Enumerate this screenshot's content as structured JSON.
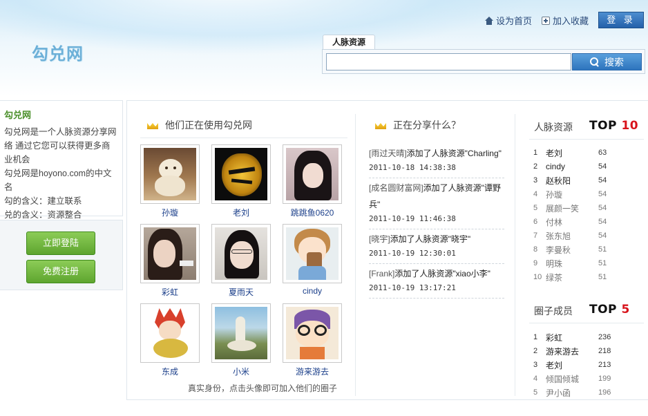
{
  "header": {
    "logo": "勾兑网",
    "set_home": "设为首页",
    "add_favorite": "加入收藏",
    "login": "登 录"
  },
  "search": {
    "tab": "人脉资源",
    "value": "",
    "button": "搜索"
  },
  "about": {
    "title": "勾兑网",
    "lines": [
      "勾兑网是一个人脉资源分享网络 通过它您可以获得更多商业机会",
      "勾兑网是hoyono.com的中文名",
      "勾的含义：建立联系",
      "兑的含义：资源整合"
    ]
  },
  "actions": {
    "login_now": "立即登陆",
    "register_free": "免费注册"
  },
  "users_section": {
    "title": "他们正在使用勾兑网",
    "users": [
      "孙璇",
      "老刘",
      "跳跳鱼0620",
      "彩虹",
      "夏雨天",
      "cindy",
      "东成",
      "小米",
      "游来游去"
    ],
    "footer": "真实身份，点击头像即可加入他们的圈子"
  },
  "share_section": {
    "title": "正在分享什么？",
    "items": [
      {
        "who": "[雨过天晴]",
        "text": "添加了人脉资源\"Charling\"",
        "time": "2011-10-18 14:38:38"
      },
      {
        "who": "[成名圆财富网]",
        "text": "添加了人脉资源\"谭野兵\"",
        "time": "2011-10-19 11:46:38"
      },
      {
        "who": "[晓宇]",
        "text": "添加了人脉资源\"晓宇\"",
        "time": "2011-10-19 12:30:01"
      },
      {
        "who": "[Frank]",
        "text": "添加了人脉资源\"xiao小李\"",
        "time": "2011-10-19 13:17:21"
      }
    ]
  },
  "rank_resources": {
    "title": "人脉资源",
    "top_word": "TOP",
    "top_num": "10",
    "rows": [
      {
        "n": "1",
        "name": "老刘",
        "v": "63"
      },
      {
        "n": "2",
        "name": "cindy",
        "v": "54"
      },
      {
        "n": "3",
        "name": "赵秋阳",
        "v": "54"
      },
      {
        "n": "4",
        "name": "孙璇",
        "v": "54"
      },
      {
        "n": "5",
        "name": "展颜一笑",
        "v": "54"
      },
      {
        "n": "6",
        "name": "付林",
        "v": "54"
      },
      {
        "n": "7",
        "name": "张东旭",
        "v": "54"
      },
      {
        "n": "8",
        "name": "李曼秋",
        "v": "51"
      },
      {
        "n": "9",
        "name": "明珠",
        "v": "51"
      },
      {
        "n": "10",
        "name": "绿茶",
        "v": "51"
      }
    ]
  },
  "rank_members": {
    "title": "圈子成员",
    "top_word": "TOP",
    "top_num": "5",
    "rows": [
      {
        "n": "1",
        "name": "彩虹",
        "v": "236"
      },
      {
        "n": "2",
        "name": "游来游去",
        "v": "218"
      },
      {
        "n": "3",
        "name": "老刘",
        "v": "213"
      },
      {
        "n": "4",
        "name": "倾国倾城",
        "v": "199"
      },
      {
        "n": "5",
        "name": "尹小函",
        "v": "196"
      }
    ]
  },
  "colors": {
    "accent_blue": "#2d74bd",
    "green_button": "#5ea52f",
    "top_red": "#d8141c"
  }
}
